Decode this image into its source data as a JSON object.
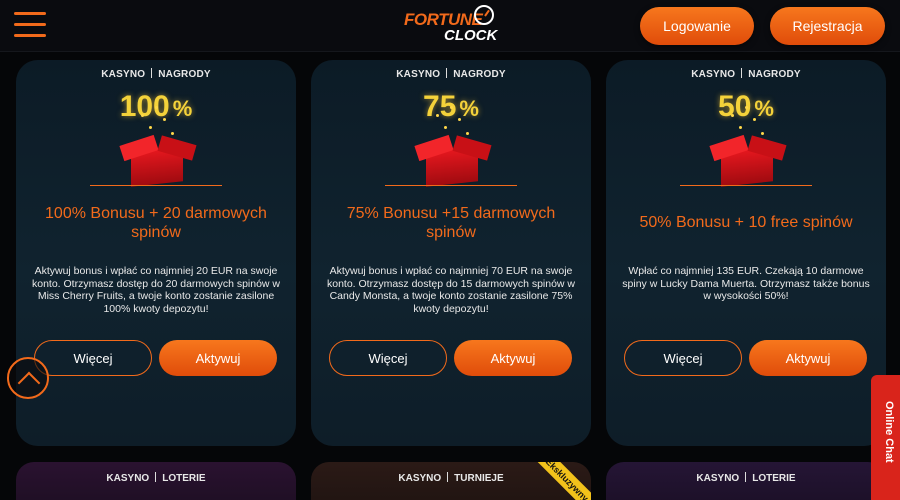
{
  "header": {
    "logo_line1": "FORTUNE",
    "logo_line2": "CLOCK",
    "login_label": "Logowanie",
    "register_label": "Rejestracja"
  },
  "cards": [
    {
      "tag1": "KASYNO",
      "tag2": "NAGRODY",
      "percent": "100",
      "percent_sign": "%",
      "title": "100% Bonusu + 20 darmowych spinów",
      "description": "Aktywuj bonus i wpłać co najmniej 20 EUR na swoje konto. Otrzymasz dostęp do 20 darmowych spinów w Miss Cherry Fruits, a twoje konto zostanie zasilone 100% kwoty depozytu!",
      "more_label": "Więcej",
      "activate_label": "Aktywuj"
    },
    {
      "tag1": "KASYNO",
      "tag2": "NAGRODY",
      "percent": "75",
      "percent_sign": "%",
      "title": "75% Bonusu +15 darmowych spinów",
      "description": "Aktywuj bonus i wpłać co najmniej 70 EUR na swoje konto. Otrzymasz dostęp do 15 darmowych spinów w Candy Monsta, a twoje konto zostanie zasilone 75% kwoty depozytu!",
      "more_label": "Więcej",
      "activate_label": "Aktywuj"
    },
    {
      "tag1": "KASYNO",
      "tag2": "NAGRODY",
      "percent": "50",
      "percent_sign": "%",
      "title": "50% Bonusu + 10 free spinów",
      "description": "Wpłać co najmniej 135 EUR. Czekają 10 darmowe spiny w Lucky Dama Muerta. Otrzymasz także bonus w wysokości 50%!",
      "more_label": "Więcej",
      "activate_label": "Aktywuj"
    }
  ],
  "bottom_cards": [
    {
      "tag1": "KASYNO",
      "tag2": "LOTERIE"
    },
    {
      "tag1": "KASYNO",
      "tag2": "TURNIEJE",
      "ribbon": "Ekskluzywny"
    },
    {
      "tag1": "KASYNO",
      "tag2": "LOTERIE"
    }
  ],
  "chat": {
    "label": "Online Chat"
  },
  "colors": {
    "accent": "#f26a1b",
    "gold": "#f4d23a",
    "chat": "#d9241b"
  }
}
